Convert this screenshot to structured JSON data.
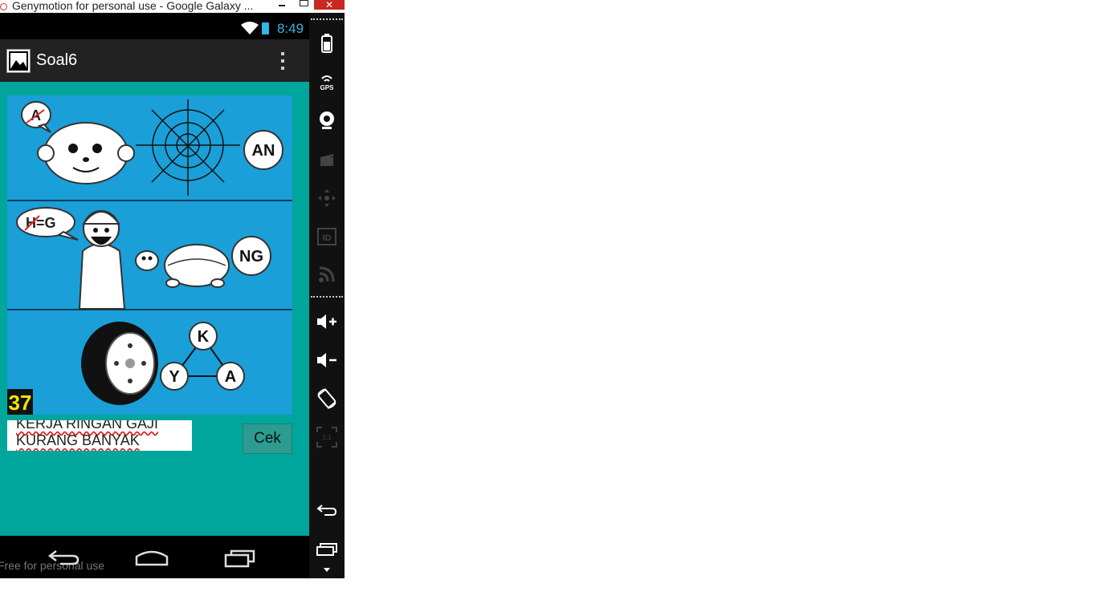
{
  "window": {
    "title": "Genymotion for personal use - Google Galaxy ..."
  },
  "status_bar": {
    "time": "8:49"
  },
  "action_bar": {
    "title": "Soal6"
  },
  "puzzle": {
    "number": "37",
    "rows": [
      {
        "bubble": "A",
        "tag": "AN"
      },
      {
        "bubble": "H=G",
        "tag": "NG"
      },
      {
        "triangle": [
          "K",
          "Y",
          "A"
        ]
      }
    ]
  },
  "answer": {
    "line1": "KERJA RINGAN GAJI",
    "line2": "KURANG BANYAK",
    "button_label": "Cek"
  },
  "nav": {
    "watermark": "Free for personal use"
  },
  "colors": {
    "content_bg": "#00a69c",
    "puzzle_bg": "#1a9fd8",
    "status_accent": "#33b5e5"
  }
}
